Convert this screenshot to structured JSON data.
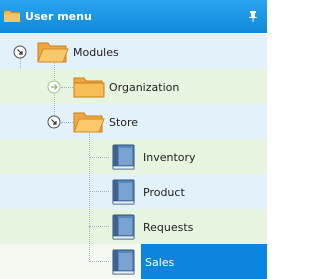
{
  "panel": {
    "title": "User menu",
    "icons": {
      "title_icon": "folder-icon",
      "pin_icon": "pin-icon"
    },
    "colors": {
      "header_bg": "#1a95e4",
      "row_blue": "#e3f1fb",
      "row_green": "#e6f5df",
      "selected_bg": "#0b86de",
      "folder": "#f3a63a"
    }
  },
  "tree": {
    "modules_label": "Modules",
    "organization_label": "Organization",
    "store_label": "Store",
    "inventory_label": "Inventory",
    "product_label": "Product",
    "requests_label": "Requests",
    "sales_label": "Sales"
  }
}
